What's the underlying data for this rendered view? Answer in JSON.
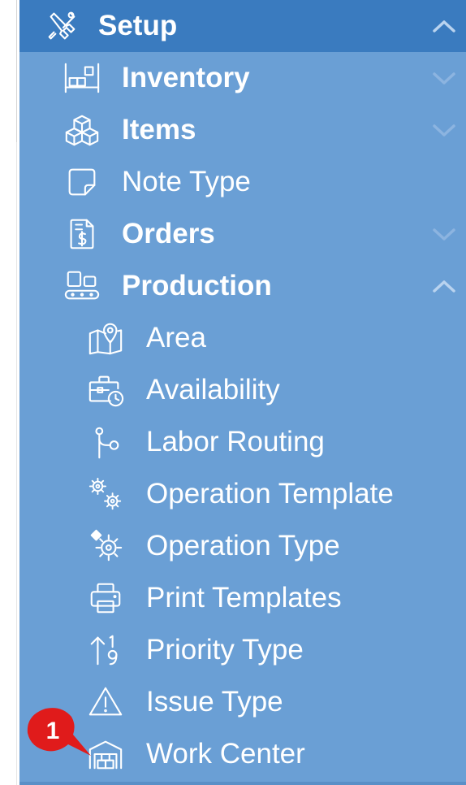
{
  "menu": {
    "header": {
      "label": "Setup",
      "icon": "tools-icon",
      "expanded": true
    },
    "items": [
      {
        "label": "Inventory",
        "icon": "shelf-icon",
        "bold": true,
        "expandable": true,
        "expanded": false
      },
      {
        "label": "Items",
        "icon": "cubes-icon",
        "bold": true,
        "expandable": true,
        "expanded": false
      },
      {
        "label": "Note Type",
        "icon": "note-icon",
        "bold": false,
        "expandable": false
      },
      {
        "label": "Orders",
        "icon": "invoice-icon",
        "bold": true,
        "expandable": true,
        "expanded": false
      },
      {
        "label": "Production",
        "icon": "conveyor-icon",
        "bold": true,
        "expandable": true,
        "expanded": true
      }
    ],
    "production_items": [
      {
        "label": "Area",
        "icon": "map-pin-icon"
      },
      {
        "label": "Availability",
        "icon": "briefcase-clock-icon"
      },
      {
        "label": "Labor Routing",
        "icon": "route-icon"
      },
      {
        "label": "Operation Template",
        "icon": "gears-icon"
      },
      {
        "label": "Operation Type",
        "icon": "gear-icon"
      },
      {
        "label": "Print Templates",
        "icon": "printer-icon"
      },
      {
        "label": "Priority Type",
        "icon": "sort-numeric-icon"
      },
      {
        "label": "Issue Type",
        "icon": "warning-icon"
      },
      {
        "label": "Work Center",
        "icon": "warehouse-icon"
      }
    ]
  },
  "annotation": {
    "number": "1",
    "color": "#e01b1b"
  },
  "colors": {
    "sidebar": "#6a9fd5",
    "header": "#3a7bbf",
    "text": "#ffffff",
    "chevron_collapsed": "#8cb4e0"
  }
}
